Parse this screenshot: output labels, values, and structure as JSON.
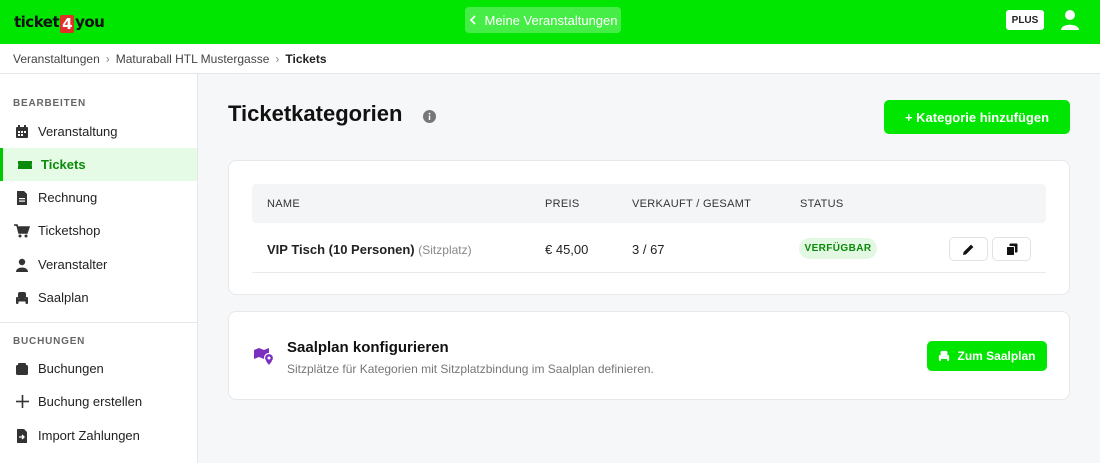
{
  "header": {
    "logo_left": "ticket",
    "logo_four": "4",
    "logo_right": "you",
    "center_button": "Meine Veranstaltungen",
    "plus_badge": "PLUS"
  },
  "breadcrumb": {
    "items": [
      "Veranstaltungen",
      "Maturaball HTL Mustergasse",
      "Tickets"
    ]
  },
  "sidebar": {
    "section_edit": "BEARBEITEN",
    "edit_items": [
      {
        "label": "Veranstaltung",
        "icon": "calendar-icon"
      },
      {
        "label": "Tickets",
        "icon": "ticket-icon"
      },
      {
        "label": "Rechnung",
        "icon": "document-icon"
      },
      {
        "label": "Ticketshop",
        "icon": "cart-icon"
      },
      {
        "label": "Veranstalter",
        "icon": "person-icon"
      },
      {
        "label": "Saalplan",
        "icon": "chair-icon"
      }
    ],
    "section_bookings": "BUCHUNGEN",
    "booking_items": [
      {
        "label": "Buchungen",
        "icon": "folder-icon"
      },
      {
        "label": "Buchung erstellen",
        "icon": "plus-icon"
      },
      {
        "label": "Import Zahlungen",
        "icon": "file-import-icon"
      }
    ]
  },
  "main": {
    "title": "Ticketkategorien",
    "add_button": "+ Kategorie hinzufügen",
    "table": {
      "columns": [
        "NAME",
        "PREIS",
        "VERKAUFT / GESAMT",
        "STATUS"
      ],
      "rows": [
        {
          "name": "VIP Tisch (10 Personen)",
          "type": "(Sitzplatz)",
          "price": "€ 45,00",
          "sold": "3 / 67",
          "status": "VERFÜGBAR"
        }
      ]
    },
    "saalplan": {
      "title": "Saalplan konfigurieren",
      "subtitle": "Sitzplätze für Kategorien mit Sitzplatzbindung im Saalplan definieren.",
      "button": "Zum Saalplan"
    }
  },
  "colors": {
    "brand_green": "#00e600",
    "active_text": "#0a8a0a",
    "map_icon": "#7b2fbf",
    "logo_four": "#e0302a"
  }
}
